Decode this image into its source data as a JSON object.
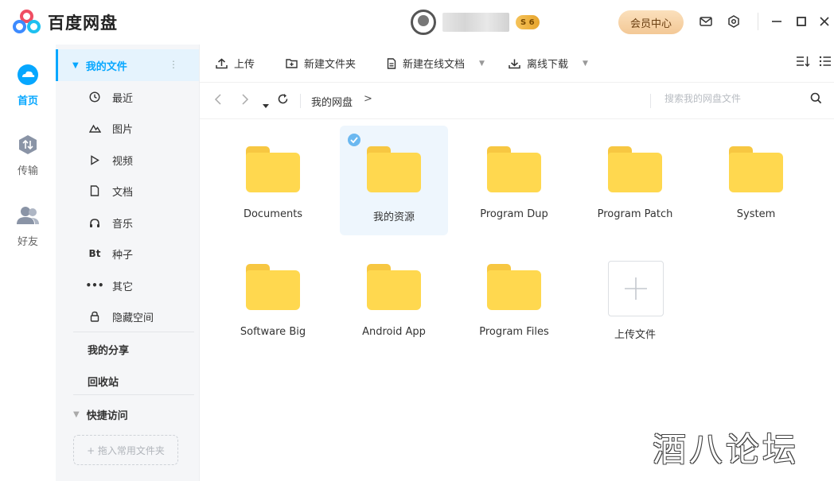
{
  "app": {
    "title": "百度网盘"
  },
  "titlebar": {
    "level_badge": "S 6",
    "vip_label": "会员中心"
  },
  "leftnav": {
    "items": [
      {
        "label": "首页",
        "icon": "cloud-icon",
        "active": true
      },
      {
        "label": "传输",
        "icon": "transfer-icon",
        "active": false
      },
      {
        "label": "好友",
        "icon": "friends-icon",
        "active": false
      }
    ]
  },
  "sidebar": {
    "my_files": "我的文件",
    "items": [
      {
        "label": "最近",
        "icon": "clock-icon"
      },
      {
        "label": "图片",
        "icon": "image-icon"
      },
      {
        "label": "视频",
        "icon": "play-icon"
      },
      {
        "label": "文档",
        "icon": "document-icon"
      },
      {
        "label": "音乐",
        "icon": "headphones-icon"
      },
      {
        "label": "种子",
        "icon": "bt-icon",
        "glyph": "Bt"
      },
      {
        "label": "其它",
        "icon": "more-dots-icon"
      },
      {
        "label": "隐藏空间",
        "icon": "lock-icon"
      }
    ],
    "my_share": "我的分享",
    "recycle": "回收站",
    "quick_access": "快捷访问",
    "drop_hint": "+ 拖入常用文件夹"
  },
  "toolbar": {
    "upload": "上传",
    "new_folder": "新建文件夹",
    "new_online_doc": "新建在线文档",
    "offline_download": "离线下载"
  },
  "addressbar": {
    "breadcrumb": "我的网盘",
    "breadcrumb_sep": ">",
    "search_placeholder": "搜索我的网盘文件"
  },
  "files": [
    {
      "name": "Documents",
      "selected": false
    },
    {
      "name": "我的资源",
      "selected": true
    },
    {
      "name": "Program Dup",
      "selected": false
    },
    {
      "name": "Program Patch",
      "selected": false
    },
    {
      "name": "System",
      "selected": false
    },
    {
      "name": "Software Big",
      "selected": false
    },
    {
      "name": "Android App",
      "selected": false
    },
    {
      "name": "Program Files",
      "selected": false
    }
  ],
  "upload_tile": {
    "label": "上传文件"
  },
  "watermark": "酒八论坛",
  "colors": {
    "accent": "#06a7ff",
    "folder": "#ffd84f",
    "vip": "#f3c896"
  }
}
